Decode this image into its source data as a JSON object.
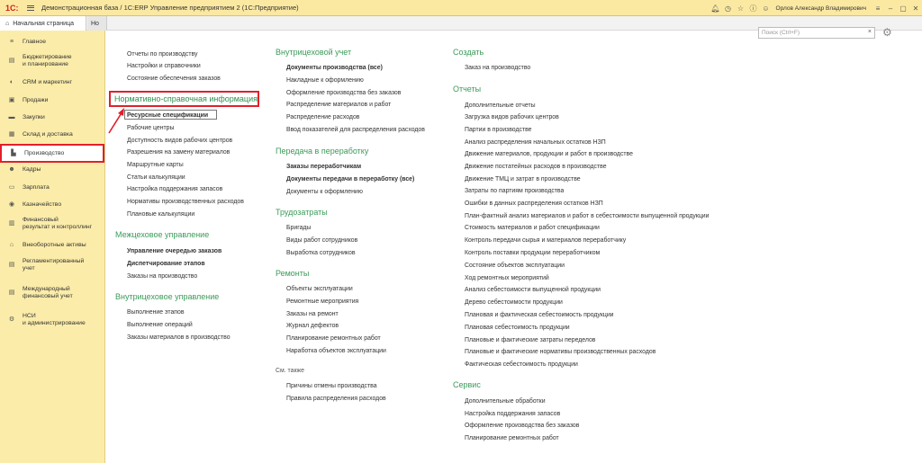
{
  "titlebar": {
    "logo": "1С:",
    "title": "Демонстрационная база / 1С:ERP Управление предприятием 2  (1С:Предприятие)",
    "user": "Орлов Александр Владимирович"
  },
  "tabs": {
    "home": "Начальная страница",
    "second": "Но"
  },
  "sidebar": [
    {
      "label": "Главное",
      "icon": "≡"
    },
    {
      "label": "Бюджетирование\nи планирование",
      "icon": "▤"
    },
    {
      "label": "CRM и маркетинг",
      "icon": "◐"
    },
    {
      "label": "Продажи",
      "icon": "▣"
    },
    {
      "label": "Закупки",
      "icon": "▬"
    },
    {
      "label": "Склад и доставка",
      "icon": "▦"
    },
    {
      "label": "Производство",
      "icon": "▙"
    },
    {
      "label": "Кадры",
      "icon": "☻"
    },
    {
      "label": "Зарплата",
      "icon": "▭"
    },
    {
      "label": "Казначейство",
      "icon": "◉"
    },
    {
      "label": "Финансовый\nрезультат и контроллинг",
      "icon": "▥"
    },
    {
      "label": "Внеоборотные активы",
      "icon": "⌂"
    },
    {
      "label": "Регламентированный\nучет",
      "icon": "▤"
    },
    {
      "label": "Международный\nфинансовый учет",
      "icon": "▤"
    },
    {
      "label": "НСИ\nи администрирование",
      "icon": "⚙"
    }
  ],
  "search": {
    "placeholder": "Поиск (Ctrl+F)"
  },
  "col1": {
    "top_links": [
      "Отчеты по производству",
      "Настройки и справочники",
      "Состояние обеспечения заказов"
    ],
    "nsi_head": "Нормативно-справочная информация",
    "nsi_links": [
      "Ресурсные спецификации",
      "Рабочие центры",
      "Доступность видов рабочих центров",
      "Разрешения на замену материалов",
      "Маршрутные карты",
      "Статьи калькуляции",
      "Настройка поддержания запасов",
      "Нормативы производственных расходов",
      "Плановые калькуляции"
    ],
    "mezh_head": "Межцеховое управление",
    "mezh_links": [
      "Управление очередью заказов",
      "Диспетчирование этапов",
      "Заказы на производство"
    ],
    "vnutr_head": "Внутрицеховое управление",
    "vnutr_links": [
      "Выполнение этапов",
      "Выполнение операций",
      "Заказы материалов в производство"
    ]
  },
  "col2": {
    "uchet_head": "Внутрицеховой учет",
    "uchet_links": [
      "Документы производства (все)",
      "Накладные к оформлению",
      "Оформление производства без заказов",
      "Распределение материалов и работ",
      "Распределение расходов",
      "Ввод показателей для распределения расходов"
    ],
    "pere_head": "Передача в переработку",
    "pere_links": [
      "Заказы переработчикам",
      "Документы передачи в переработку (все)",
      "Документы к оформлению"
    ],
    "trud_head": "Трудозатраты",
    "trud_links": [
      "Бригады",
      "Виды работ сотрудников",
      "Выработка сотрудников"
    ],
    "rem_head": "Ремонты",
    "rem_links": [
      "Объекты эксплуатации",
      "Ремонтные мероприятия",
      "Заказы на ремонт",
      "Журнал дефектов",
      "Планирование ремонтных работ",
      "Наработка объектов эксплуатации"
    ],
    "see_head": "См. также",
    "see_links": [
      "Причины отмены производства",
      "Правила распределения расходов"
    ]
  },
  "col3": {
    "create_head": "Создать",
    "create_links": [
      "Заказ на производство"
    ],
    "rep_head": "Отчеты",
    "rep_links": [
      "Дополнительные отчеты",
      "Загрузка видов рабочих центров",
      "Партии в производстве",
      "Анализ распределения начальных остатков НЗП",
      "Движение материалов, продукции и работ в производстве",
      "Движение постатейных расходов в производстве",
      "Движение ТМЦ и затрат в производстве",
      "Затраты по партиям производства",
      "Ошибки в данных распределения остатков НЗП",
      "План-фактный анализ материалов и работ в себестоимости выпущенной продукции",
      "Стоимость материалов и работ спецификации",
      "Контроль передачи сырья и материалов переработчику",
      "Контроль поставки продукции переработчиком",
      "Состояние объектов эксплуатации",
      "Ход ремонтных мероприятий",
      "Анализ себестоимости выпущенной продукции",
      "Дерево себестоимости продукции",
      "Плановая и фактическая себестоимость продукции",
      "Плановая себестоимость продукции",
      "Плановые и фактические затраты переделов",
      "Плановые и фактические нормативы производственных расходов",
      "Фактическая себестоимость продукции"
    ],
    "serv_head": "Сервис",
    "serv_links": [
      "Дополнительные обработки",
      "Настройка поддержания запасов",
      "Оформление производства без заказов",
      "Планирование ремонтных работ"
    ]
  }
}
